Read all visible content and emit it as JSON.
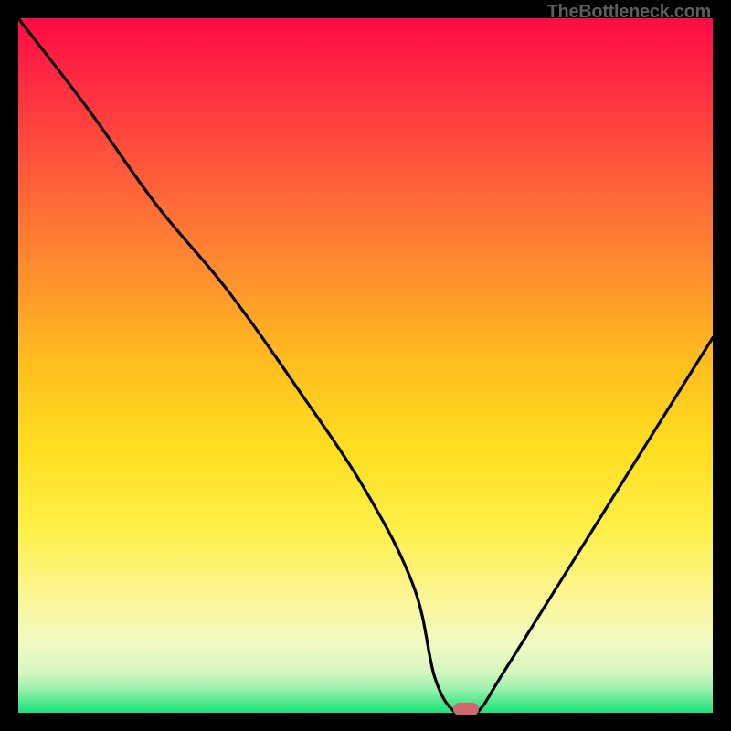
{
  "attribution": "TheBottleneck.com",
  "colors": {
    "top": "#ff0b44",
    "mid_upper": "#ff6f3c",
    "mid": "#ffd21a",
    "lower": "#fdf36f",
    "pale": "#f5f9c9",
    "green": "#18e47c",
    "curve": "#000000",
    "marker": "#cc6a6b",
    "frame": "#000000"
  },
  "chart_data": {
    "type": "line",
    "title": "",
    "xlabel": "",
    "ylabel": "",
    "xlim": [
      0,
      100
    ],
    "ylim": [
      0,
      100
    ],
    "series": [
      {
        "name": "bottleneck-curve",
        "x": [
          0,
          10,
          20,
          30,
          40,
          50,
          57,
          60,
          63,
          66,
          70,
          80,
          90,
          100
        ],
        "y": [
          100,
          87,
          73,
          61,
          47,
          32,
          18,
          5,
          0,
          0,
          6,
          22,
          38,
          54
        ]
      }
    ],
    "optimum_marker": {
      "x": 64.5,
      "y": 0
    },
    "gradient_bands_pct_from_top": [
      {
        "at": 0,
        "color": "#ff0b44"
      },
      {
        "at": 20,
        "color": "#ff5a3a"
      },
      {
        "at": 45,
        "color": "#ffc21a"
      },
      {
        "at": 68,
        "color": "#ffe72a"
      },
      {
        "at": 82,
        "color": "#fbf592"
      },
      {
        "at": 92,
        "color": "#eef9c8"
      },
      {
        "at": 96.5,
        "color": "#a6f0b0"
      },
      {
        "at": 100,
        "color": "#17e37a"
      }
    ]
  }
}
